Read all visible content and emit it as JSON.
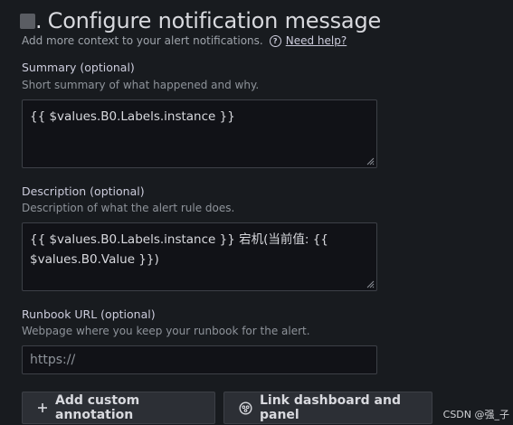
{
  "section": {
    "number_dot": ".",
    "title": "Configure notification message",
    "subtitle": "Add more context to your alert notifications.",
    "help_link": "Need help?",
    "help_icon": "question-circle-icon"
  },
  "fields": {
    "summary": {
      "label": "Summary (optional)",
      "description": "Short summary of what happened and why.",
      "value": "{{ $values.B0.Labels.instance }}"
    },
    "description": {
      "label": "Description (optional)",
      "description": "Description of what the alert rule does.",
      "value_line1": "{{ $values.B0.Labels.instance }} 宕机(当前值: {{",
      "value_line2": "$values.B0.Value }})"
    },
    "runbook": {
      "label": "Runbook URL (optional)",
      "description": "Webpage where you keep your runbook for the alert.",
      "placeholder": "https://",
      "value": ""
    }
  },
  "buttons": {
    "add_annotation": {
      "label": "Add custom annotation",
      "icon": "plus-icon"
    },
    "link_dashboard": {
      "label": "Link dashboard and panel",
      "icon": "apps-icon"
    }
  },
  "watermark": "CSDN @强_子"
}
